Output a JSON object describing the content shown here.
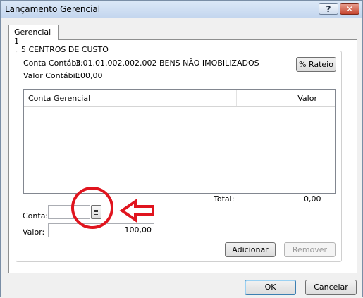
{
  "window": {
    "title": "Lançamento Gerencial",
    "help_label": "?",
    "close_label": "✕"
  },
  "tabs": [
    {
      "label": "Gerencial 1"
    }
  ],
  "group": {
    "title": "5  CENTROS DE CUSTO",
    "conta_contabil_label": "Conta Contábil:",
    "conta_contabil_value": "3.01.01.002.002.002  BENS NÃO IMOBILIZADOS",
    "valor_contabil_label": "Valor Contábil:",
    "valor_contabil_value": "100,00",
    "rateio_button": "% Rateio"
  },
  "grid": {
    "columns": [
      "Conta Gerencial",
      "Valor"
    ],
    "rows": [],
    "total_label": "Total:",
    "total_value": "0,00"
  },
  "form": {
    "conta_label": "Conta:",
    "conta_value": "",
    "valor_label": "Valor:",
    "valor_value": "100,00",
    "lookup_icon": "list-lookup-icon"
  },
  "actions": {
    "adicionar": "Adicionar",
    "remover": "Remover",
    "ok": "OK",
    "cancelar": "Cancelar"
  },
  "annotation": {
    "color": "#e0141e"
  }
}
